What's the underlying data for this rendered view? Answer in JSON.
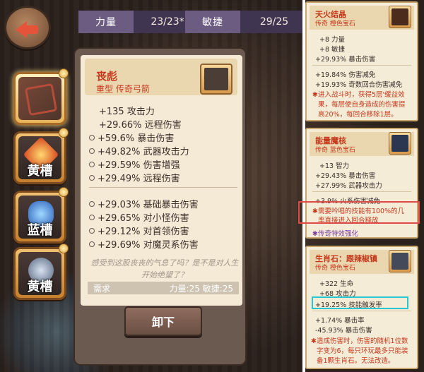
{
  "header": {
    "stats": [
      {
        "key": "力量",
        "value": "23/23*"
      },
      {
        "key": "敏捷",
        "value": "29/25"
      }
    ]
  },
  "slots": [
    {
      "label": "",
      "name": "weapon"
    },
    {
      "label": "黄槽"
    },
    {
      "label": "蓝槽"
    },
    {
      "label": "黄槽"
    }
  ],
  "card": {
    "title": "丧彪",
    "subtitle": "重型 传奇弓箭",
    "base_stats": [
      "+135 攻击力",
      "+29.66% 远程伤害"
    ],
    "stats_a": [
      "+59.6% 暴击伤害",
      "+49.82% 武器攻击力",
      "+29.59% 伤害增强",
      "+29.49% 远程伤害"
    ],
    "stats_b": [
      "+29.03% 基础暴击伤害",
      "+29.65% 对小怪伤害",
      "+29.12% 对首领伤害",
      "+29.69% 对魔灵系伤害"
    ],
    "flavor": "感受到这股丧丧的气息了吗？是不是对人生开始绝望了？",
    "req_label": "需求",
    "req_value": "力量:25 敏捷:25",
    "unequip": "卸下"
  },
  "panels": [
    {
      "title": "天火结晶",
      "subtitle": "传奇 橙色宝石",
      "lines": [
        "+8 力量",
        "+8 敏捷",
        "+29.93% 暴击伤害"
      ],
      "lines2": [
        "+19.84% 伤害减免",
        "+19.93% 奇数回合伤害减免"
      ],
      "effect": [
        "✱进入战斗时，获得5层'缓益效",
        "果，每层使自身造成的伤害提",
        "高20%，每回合移除1层。"
      ]
    },
    {
      "title": "能量魔核",
      "subtitle": "传奇 蓝色宝石",
      "lines": [
        "+13 智力",
        "+29.43% 暴击伤害",
        "+27.99% 武器攻击力"
      ],
      "lines2": [
        "+3.9% 火系伤害减免"
      ],
      "effect": [
        "✱需要吟唱的技能有100%的几",
        "率直接进入回合释放"
      ],
      "legend": "✱传奇特效强化"
    },
    {
      "title": "生肖石：跟辣椒镇",
      "subtitle": "传奇 橙色宝石",
      "lines": [
        "+322 生命",
        "+68 攻击力",
        "+19.25% 技能触发率"
      ],
      "lines2": [
        "+1.74% 暴击率",
        "-45.93% 暴击伤害"
      ],
      "effect": [
        "✱造成伤害时，伤害的随机1位数",
        "字变为6，每只环玩最多只能装",
        "备1颗生肖石。无法改造。"
      ]
    }
  ]
}
